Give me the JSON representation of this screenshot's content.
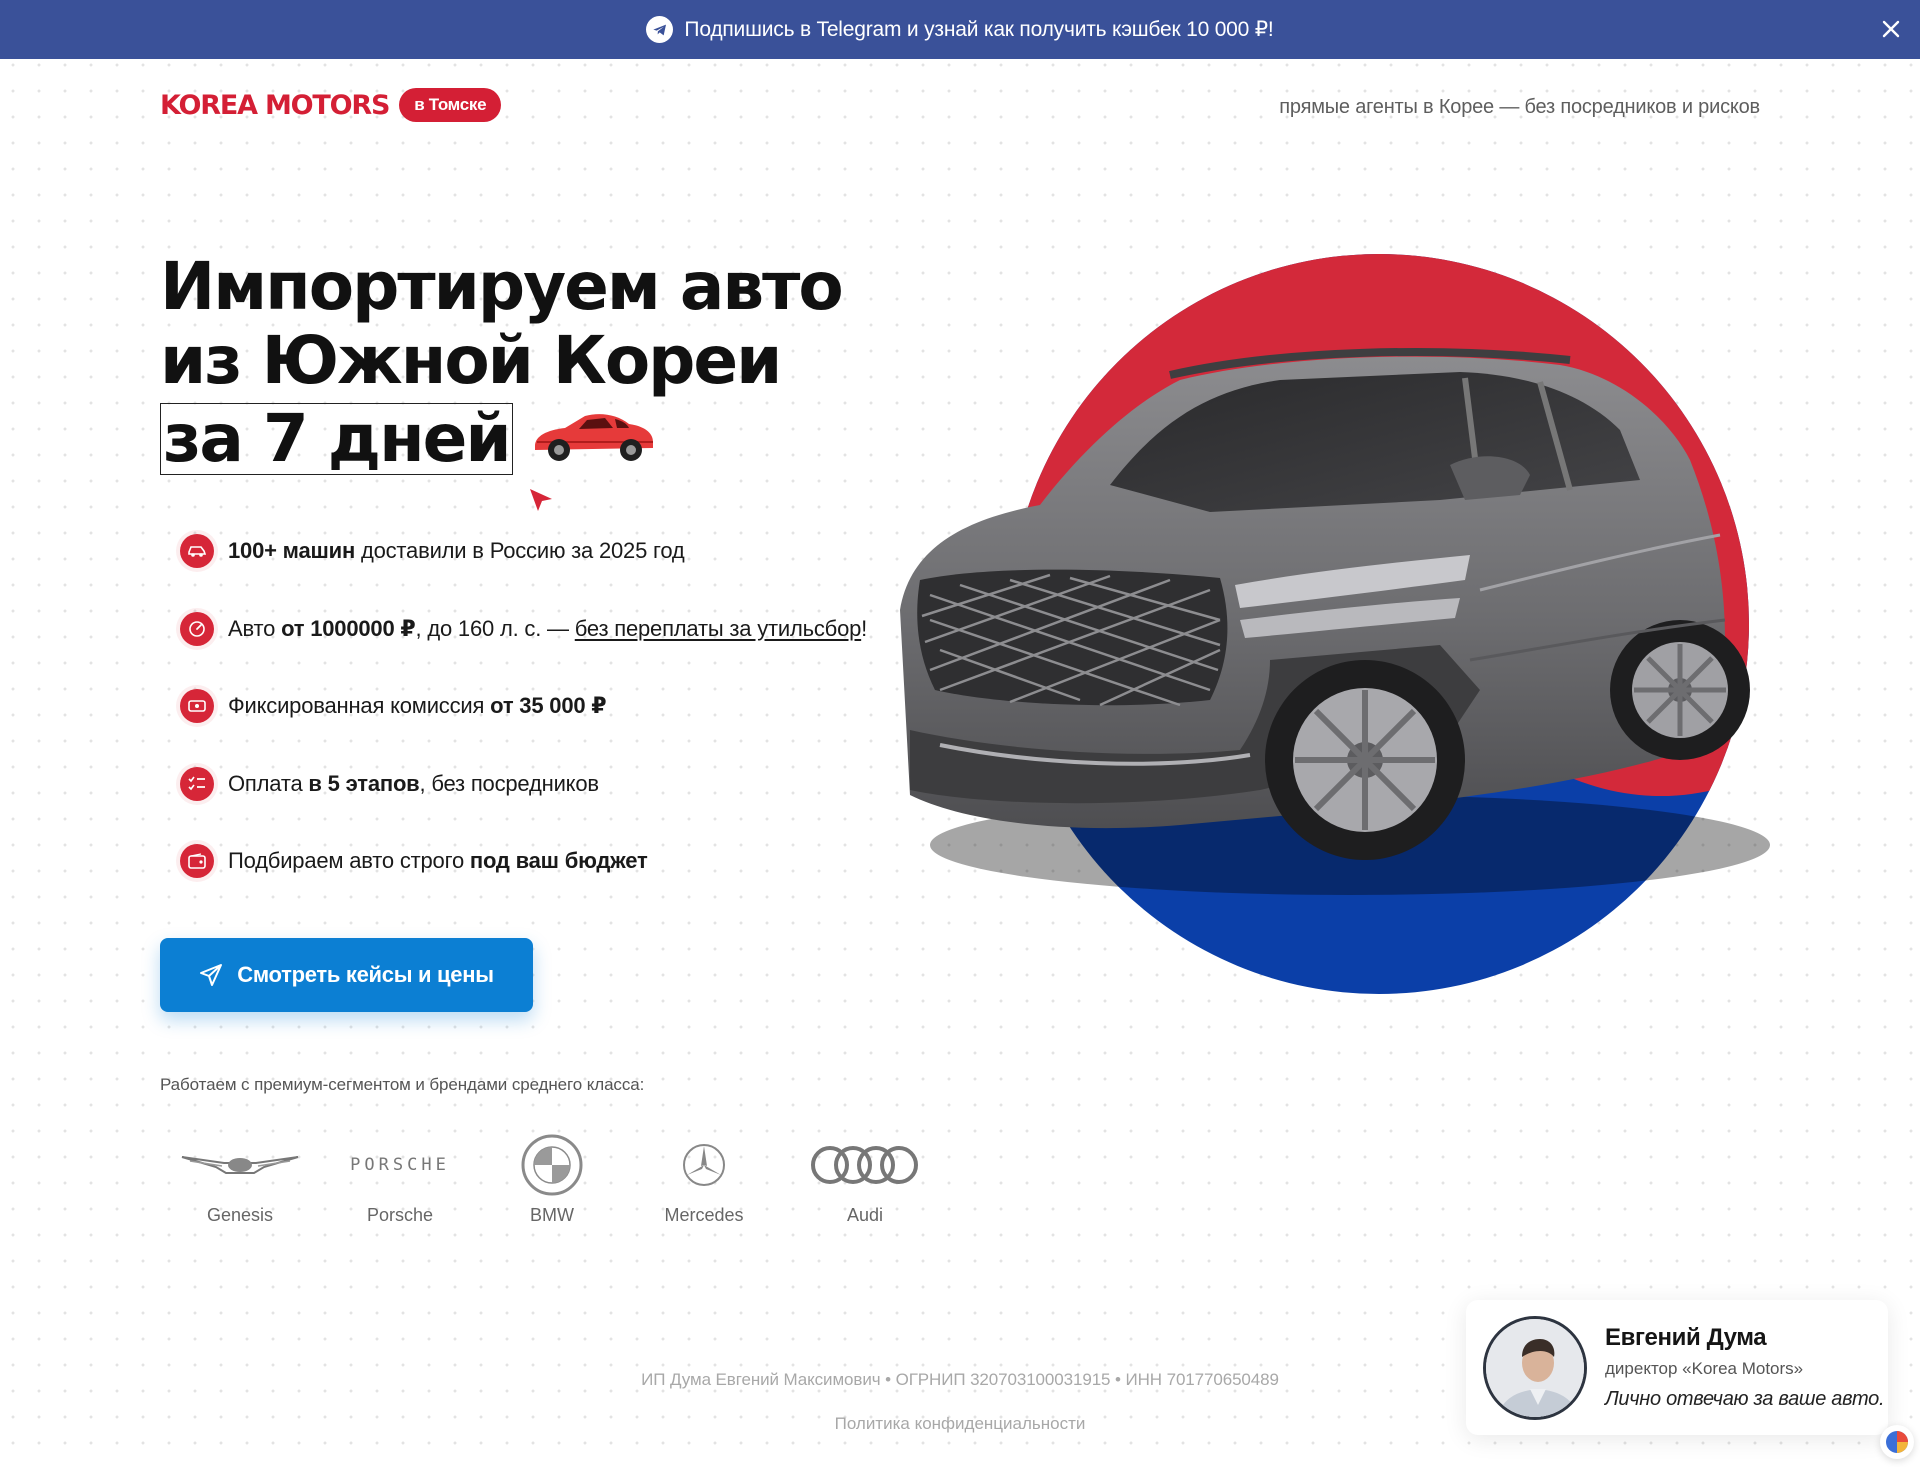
{
  "banner": {
    "text": "Подпишись в Telegram и узнай как получить кэшбек 10 000 ₽!",
    "icon": "telegram-icon",
    "close_icon": "close-icon",
    "background": "#3a5199"
  },
  "header": {
    "logo": "KOREA MOTORS",
    "city_badge": "в Томске",
    "tagline": "прямые агенты в Корее — без посредников и рисков"
  },
  "hero": {
    "title_line1": "Импортируем авто",
    "title_line2": "из Южной Кореи",
    "title_line3": "за 7 дней",
    "features": [
      {
        "icon": "car-icon",
        "bold": "100+ машин",
        "text": " доставили в Россию за 2025 год"
      },
      {
        "icon": "speedometer-icon",
        "pre": "Авто ",
        "bold": "от 1000000 ₽",
        "mid": ", до 160 л. с. — ",
        "link": "без переплаты за утильсбор",
        "post": "!"
      },
      {
        "icon": "money-icon",
        "pre": "Фиксированная комиссия ",
        "bold": "от 35 000 ₽"
      },
      {
        "icon": "checklist-icon",
        "pre": "Оплата ",
        "bold": "в 5 этапов",
        "post": ", без посредников"
      },
      {
        "icon": "wallet-icon",
        "pre": "Подбираем авто строго ",
        "bold": "под ваш бюджет"
      }
    ],
    "cta_label": "Смотреть кейсы и цены"
  },
  "brands": {
    "title": "Работаем с премиум-сегментом и брендами среднего класса:",
    "items": [
      {
        "name": "Genesis",
        "icon": "genesis-logo"
      },
      {
        "name": "Porsche",
        "icon": "porsche-logo",
        "wordmark": "PORSCHE"
      },
      {
        "name": "BMW",
        "icon": "bmw-logo",
        "wordmark": "BMW"
      },
      {
        "name": "Mercedes",
        "icon": "mercedes-logo"
      },
      {
        "name": "Audi",
        "icon": "audi-logo"
      }
    ]
  },
  "footer": {
    "legal": "ИП Дума Евгений Максимович • ОГРНИП 320703100031915 • ИНН 701770650489",
    "privacy": "Политика конфиденциальности"
  },
  "director": {
    "name": "Евгений Дума",
    "role": "директор «Korea Motors»",
    "quote": "Лично отвечаю за ваше авто."
  },
  "colors": {
    "brand_red": "#d41f35",
    "accent_blue": "#0c7fd3",
    "circle_red": "#d3293a",
    "circle_blue": "#0b3fa8"
  }
}
